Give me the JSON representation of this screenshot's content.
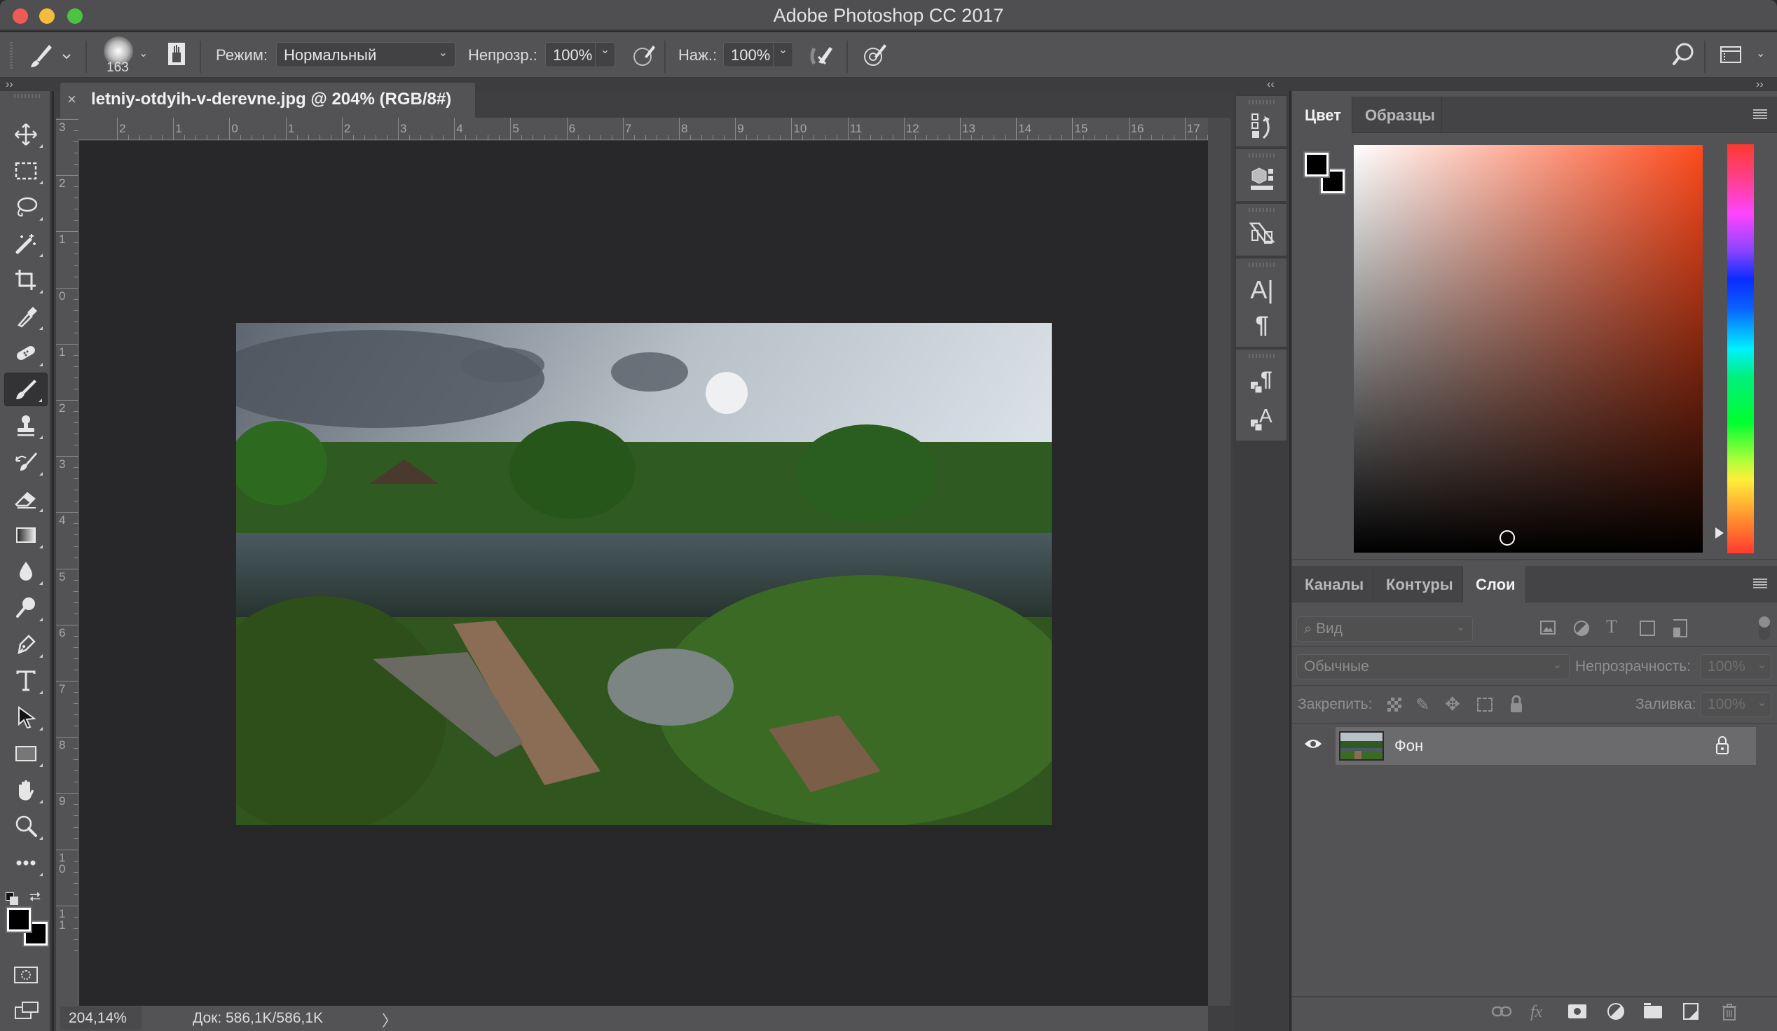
{
  "app": {
    "title": "Adobe Photoshop CC 2017",
    "window_controls": [
      {
        "name": "close",
        "color": "#ee5b55"
      },
      {
        "name": "minimize",
        "color": "#f5bc3b"
      },
      {
        "name": "zoom",
        "color": "#4bc441"
      }
    ]
  },
  "options_bar": {
    "brush_size": "163",
    "mode_label": "Режим:",
    "mode_value": "Нормальный",
    "opacity_label": "Непрозр.:",
    "opacity_value": "100%",
    "pressure_label": "Наж.:",
    "pressure_value": "100%"
  },
  "document": {
    "tab_close": "×",
    "tab_title": "letniy-otdyih-v-derevne.jpg @ 204% (RGB/8#)",
    "ruler_top_labels": [
      "2",
      "1",
      "0",
      "1",
      "2",
      "3",
      "4",
      "5",
      "6",
      "7",
      "8",
      "9",
      "10",
      "11",
      "12",
      "13",
      "14",
      "15",
      "16",
      "17"
    ],
    "ruler_left_labels": [
      "3",
      "2",
      "1",
      "0",
      "1",
      "2",
      "3",
      "4",
      "5",
      "6",
      "7",
      "8",
      "9",
      "10",
      "11"
    ]
  },
  "status_bar": {
    "zoom": "204,14%",
    "doc_info": "Док: 586,1K/586,1K",
    "arrow": "〉"
  },
  "tools": [
    {
      "name": "move-tool",
      "icon": "move-icon"
    },
    {
      "name": "marquee-tool",
      "icon": "rect-marquee-icon"
    },
    {
      "name": "lasso-tool",
      "icon": "lasso-icon"
    },
    {
      "name": "magic-wand-tool",
      "icon": "magic-wand-icon"
    },
    {
      "name": "crop-tool",
      "icon": "crop-icon"
    },
    {
      "name": "eyedropper-tool",
      "icon": "eyedropper-icon"
    },
    {
      "name": "healing-brush-tool",
      "icon": "bandage-icon"
    },
    {
      "name": "brush-tool",
      "icon": "brush-icon",
      "active": true
    },
    {
      "name": "clone-stamp-tool",
      "icon": "stamp-icon"
    },
    {
      "name": "history-brush-tool",
      "icon": "history-brush-icon"
    },
    {
      "name": "eraser-tool",
      "icon": "eraser-icon"
    },
    {
      "name": "gradient-tool",
      "icon": "gradient-icon"
    },
    {
      "name": "blur-tool",
      "icon": "drop-icon"
    },
    {
      "name": "dodge-tool",
      "icon": "dodge-icon"
    },
    {
      "name": "pen-tool",
      "icon": "pen-icon"
    },
    {
      "name": "type-tool",
      "icon": "type-icon"
    },
    {
      "name": "path-selection-tool",
      "icon": "arrow-icon"
    },
    {
      "name": "rectangle-tool",
      "icon": "rectangle-icon"
    },
    {
      "name": "hand-tool",
      "icon": "hand-icon"
    },
    {
      "name": "zoom-tool",
      "icon": "zoom-icon"
    },
    {
      "name": "edit-toolbar",
      "icon": "more-icon"
    }
  ],
  "colors": {
    "foreground": "#000000",
    "background": "#000000",
    "picker_hue": "#ff4a1c"
  },
  "color_panel": {
    "tabs": [
      {
        "label": "Цвет",
        "active": true
      },
      {
        "label": "Образцы",
        "active": false
      }
    ]
  },
  "layers_panel": {
    "tabs": [
      {
        "label": "Каналы",
        "active": false
      },
      {
        "label": "Контуры",
        "active": false
      },
      {
        "label": "Слои",
        "active": true
      }
    ],
    "filter_placeholder": "Вид",
    "blend_mode": "Обычные",
    "opacity_label": "Непрозрачность:",
    "opacity_value": "100%",
    "lock_label": "Закрепить:",
    "fill_label": "Заливка:",
    "fill_value": "100%",
    "layers": [
      {
        "name": "Фон",
        "visible": true,
        "locked": true
      }
    ]
  }
}
